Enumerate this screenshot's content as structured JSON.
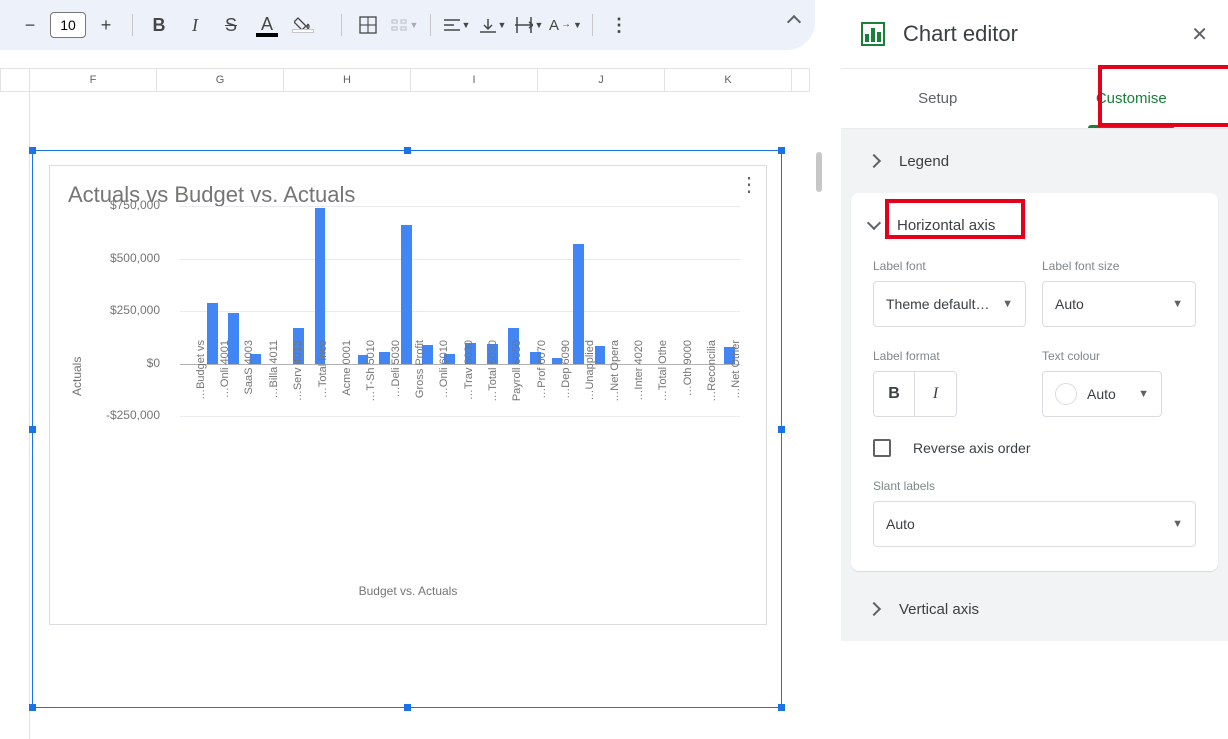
{
  "toolbar": {
    "fontSize": "10"
  },
  "columns": [
    "F",
    "G",
    "H",
    "I",
    "J",
    "K"
  ],
  "editor": {
    "title": "Chart editor",
    "tab_setup": "Setup",
    "tab_customise": "Customise",
    "section_legend": "Legend",
    "section_haxis": "Horizontal axis",
    "section_vaxis": "Vertical axis",
    "label_font": "Label font",
    "label_font_val": "Theme default…",
    "label_font_size": "Label font size",
    "label_font_size_val": "Auto",
    "label_format": "Label format",
    "text_colour": "Text colour",
    "text_colour_val": "Auto",
    "reverse": "Reverse axis order",
    "slant": "Slant labels",
    "slant_val": "Auto"
  },
  "chart_data": {
    "type": "bar",
    "title": "Actuals vs Budget vs. Actuals",
    "xlabel": "Budget vs. Actuals",
    "ylabel": "Actuals",
    "ylim": [
      -250000,
      750000
    ],
    "yticks": [
      "$750,000",
      "$500,000",
      "$250,000",
      "$0",
      "-$250,000"
    ],
    "categories": [
      "Budget vs…",
      "4001 Onli…",
      "4003 SaaS",
      "4011 Billa…",
      "4013 Serv…",
      "Total Inco…",
      "0001 Acme",
      "5010 T-Sh…",
      "5030 Deli…",
      "Gross Profit",
      "6010 Onli…",
      "6030 Trav…",
      "Total 6030…",
      "6050 Payroll",
      "6070 Prof…",
      "6090 Dep…",
      "Unapplied…",
      "Net Opera…",
      "4020 Inter…",
      "Total Othe…",
      "9000 Oth…",
      "Reconcilia…",
      "Net Other…"
    ],
    "values": [
      0,
      290000,
      240000,
      45000,
      0,
      170000,
      740000,
      0,
      40000,
      55000,
      660000,
      90000,
      45000,
      100000,
      95000,
      170000,
      55000,
      25000,
      570000,
      85000,
      0,
      0,
      0,
      0,
      0,
      80000
    ]
  }
}
